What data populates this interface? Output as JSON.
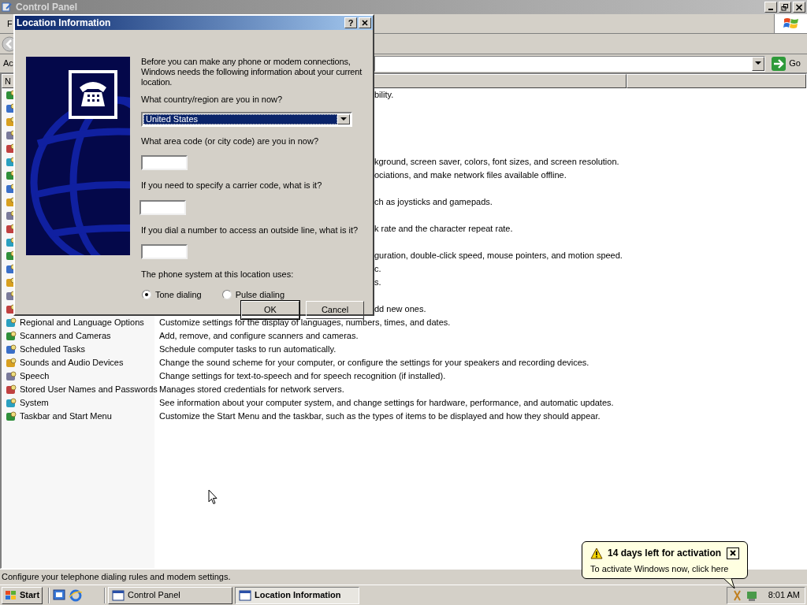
{
  "window": {
    "title": "Control Panel",
    "menu_fragment": "F",
    "address_fragment": "Ac",
    "go_button": "Go",
    "column_fragment": "N"
  },
  "items": [
    {
      "kind": "covered",
      "fragment": "bility."
    },
    {
      "kind": "covered"
    },
    {
      "kind": "covered"
    },
    {
      "kind": "covered"
    },
    {
      "kind": "covered"
    },
    {
      "kind": "covered",
      "fragment": "kground, screen saver, colors, font sizes, and screen resolution."
    },
    {
      "kind": "covered",
      "fragment": "ociations, and make network files available offline."
    },
    {
      "kind": "covered"
    },
    {
      "kind": "covered",
      "fragment": "ch as joysticks and gamepads."
    },
    {
      "kind": "covered"
    },
    {
      "kind": "covered",
      "fragment": "k rate and the character repeat rate."
    },
    {
      "kind": "covered"
    },
    {
      "kind": "covered",
      "fragment": "guration, double-click speed, mouse pointers, and motion speed."
    },
    {
      "kind": "covered",
      "fragment": "c."
    },
    {
      "kind": "covered",
      "fragment": "s."
    },
    {
      "kind": "covered"
    },
    {
      "kind": "covered",
      "fragment": "dd new ones."
    },
    {
      "kind": "full",
      "name": "Regional and Language Options",
      "description": "Customize settings for the display of languages, numbers, times, and dates."
    },
    {
      "kind": "full",
      "name": "Scanners and Cameras",
      "description": "Add, remove, and configure scanners and cameras."
    },
    {
      "kind": "full",
      "name": "Scheduled Tasks",
      "description": "Schedule computer tasks to run automatically."
    },
    {
      "kind": "full",
      "name": "Sounds and Audio Devices",
      "description": "Change the sound scheme for your computer, or configure the settings for your speakers and recording devices."
    },
    {
      "kind": "full",
      "name": "Speech",
      "description": "Change settings for text-to-speech and for speech recognition (if installed)."
    },
    {
      "kind": "full",
      "name": "Stored User Names and Passwords",
      "description": "Manages stored credentials for network servers."
    },
    {
      "kind": "full",
      "name": "System",
      "description": "See information about your computer system, and change settings for hardware, performance, and automatic updates."
    },
    {
      "kind": "full",
      "name": "Taskbar and Start Menu",
      "description": "Customize the Start Menu and the taskbar, such as the types of items to be displayed and how they should appear."
    }
  ],
  "status_bar": "Configure your telephone dialing rules and modem settings.",
  "dialog": {
    "title": "Location Information",
    "help": "?",
    "intro": "Before you can make any phone or modem connections, Windows needs the following information about your current location.",
    "country_label": "What country/region are you in now?",
    "country_value": "United States",
    "area_code_label": "What area code (or city code) are you in now?",
    "carrier_label": "If you need to specify a carrier code, what is it?",
    "outside_line_label": "If you dial a number to access an outside line, what is it?",
    "phone_system_label": "The phone system at this location uses:",
    "dialing": [
      {
        "label": "Tone dialing",
        "selected": true
      },
      {
        "label": "Pulse dialing",
        "selected": false
      }
    ],
    "buttons": [
      "OK",
      "Cancel"
    ]
  },
  "taskbar": {
    "start": "Start",
    "tasks": [
      {
        "label": "Control Panel",
        "selected": false
      },
      {
        "label": "Location Information",
        "selected": true
      }
    ],
    "clock": "8:01 AM"
  },
  "balloon": {
    "title": "14 days left for activation",
    "text": "To activate Windows now, click here"
  }
}
